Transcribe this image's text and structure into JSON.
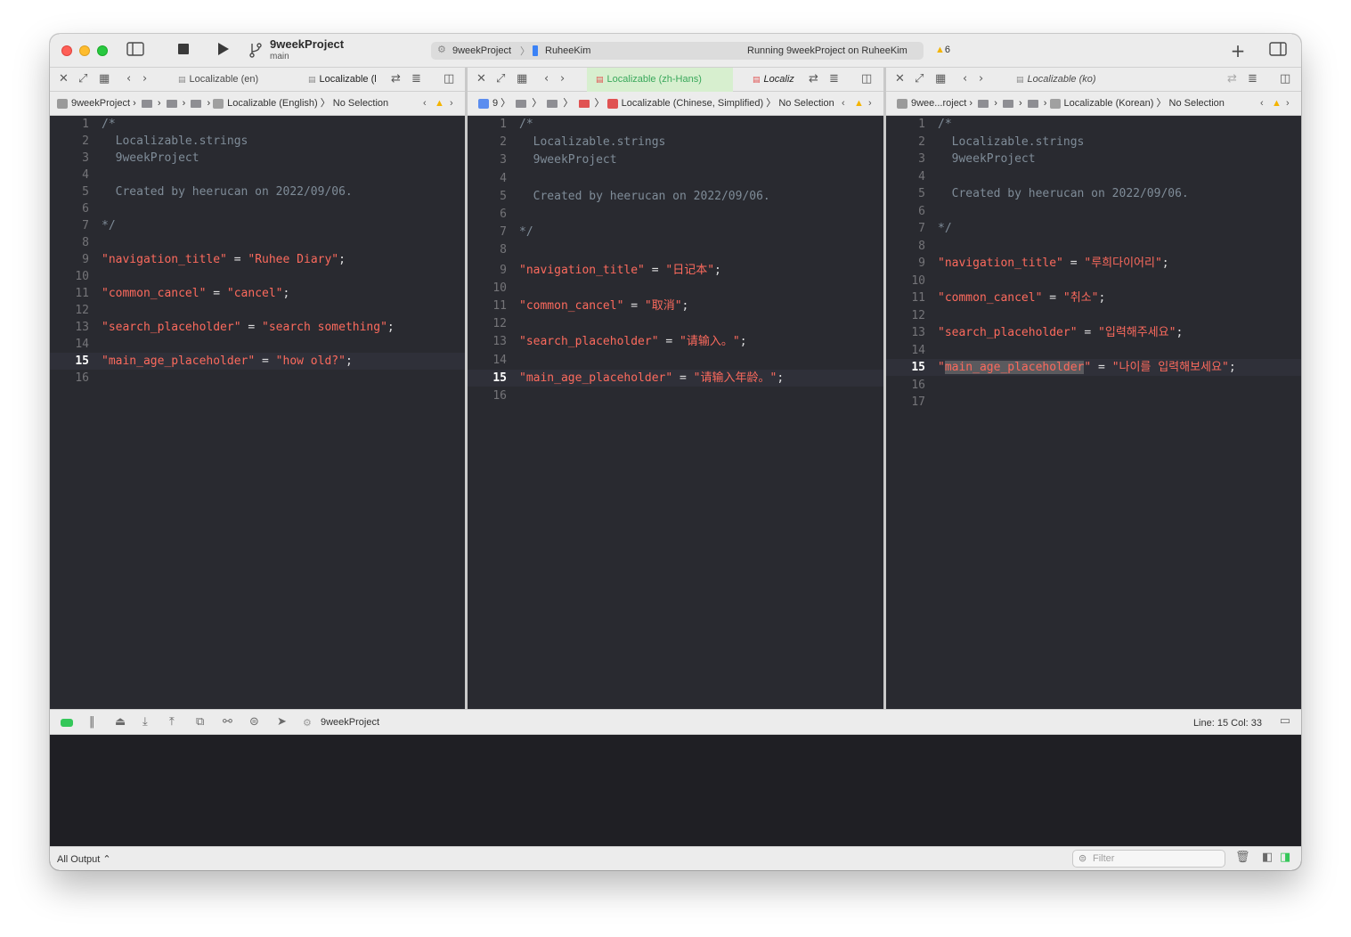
{
  "toolbar": {
    "project_title": "9weekProject",
    "branch": "main",
    "scheme_project": "9weekProject",
    "scheme_device": "RuheeKim",
    "status": "Running 9weekProject on RuheeKim",
    "warning_count": "6"
  },
  "editors": [
    {
      "tabs": [
        {
          "label": "Localizable (en)",
          "active": false
        },
        {
          "label": "Localizable (l",
          "active": false
        }
      ],
      "jumpbar": {
        "project": "9weekProject",
        "file": "Localizable (English)",
        "selection": "No Selection"
      },
      "lines": [
        {
          "n": "1",
          "parts": [
            {
              "c": "cm",
              "t": "/*"
            }
          ]
        },
        {
          "n": "2",
          "parts": [
            {
              "c": "cm",
              "t": "  Localizable.strings"
            }
          ]
        },
        {
          "n": "3",
          "parts": [
            {
              "c": "cm",
              "t": "  9weekProject"
            }
          ]
        },
        {
          "n": "4",
          "parts": []
        },
        {
          "n": "5",
          "parts": [
            {
              "c": "cm",
              "t": "  Created by heerucan on 2022/09/06."
            }
          ]
        },
        {
          "n": "6",
          "parts": []
        },
        {
          "n": "7",
          "parts": [
            {
              "c": "cm",
              "t": "*/"
            }
          ]
        },
        {
          "n": "8",
          "parts": []
        },
        {
          "n": "9",
          "parts": [
            {
              "c": "str",
              "t": "\"navigation_title\""
            },
            {
              "c": "op",
              "t": " = "
            },
            {
              "c": "str",
              "t": "\"Ruhee Diary\""
            },
            {
              "c": "op",
              "t": ";"
            }
          ]
        },
        {
          "n": "10",
          "parts": []
        },
        {
          "n": "11",
          "parts": [
            {
              "c": "str",
              "t": "\"common_cancel\""
            },
            {
              "c": "op",
              "t": " = "
            },
            {
              "c": "str",
              "t": "\"cancel\""
            },
            {
              "c": "op",
              "t": ";"
            }
          ]
        },
        {
          "n": "12",
          "parts": []
        },
        {
          "n": "13",
          "parts": [
            {
              "c": "str",
              "t": "\"search_placeholder\""
            },
            {
              "c": "op",
              "t": " = "
            },
            {
              "c": "str",
              "t": "\"search something\""
            },
            {
              "c": "op",
              "t": ";"
            }
          ]
        },
        {
          "n": "14",
          "parts": []
        },
        {
          "n": "15",
          "current": true,
          "parts": [
            {
              "c": "str",
              "t": "\"main_age_placeholder\""
            },
            {
              "c": "op",
              "t": " = "
            },
            {
              "c": "str",
              "t": "\"how old?\""
            },
            {
              "c": "op",
              "t": ";"
            }
          ]
        },
        {
          "n": "16",
          "parts": []
        }
      ]
    },
    {
      "tabs": [
        {
          "label": "Localizable (zh-Hans)",
          "active": true
        },
        {
          "label": "Localiz",
          "active": false
        }
      ],
      "jumpbar": {
        "project": "9",
        "file": "Localizable (Chinese, Simplified)",
        "selection": "No Selection"
      },
      "lines": [
        {
          "n": "1",
          "parts": [
            {
              "c": "cm",
              "t": "/*"
            }
          ]
        },
        {
          "n": "2",
          "parts": [
            {
              "c": "cm",
              "t": "  Localizable.strings"
            }
          ]
        },
        {
          "n": "3",
          "parts": [
            {
              "c": "cm",
              "t": "  9weekProject"
            }
          ]
        },
        {
          "n": "4",
          "parts": []
        },
        {
          "n": "5",
          "parts": [
            {
              "c": "cm",
              "t": "  Created by heerucan on 2022/09/06."
            }
          ]
        },
        {
          "n": "6",
          "parts": []
        },
        {
          "n": "7",
          "parts": [
            {
              "c": "cm",
              "t": "*/"
            }
          ]
        },
        {
          "n": "8",
          "parts": []
        },
        {
          "n": "9",
          "parts": [
            {
              "c": "str",
              "t": "\"navigation_title\""
            },
            {
              "c": "op",
              "t": " = "
            },
            {
              "c": "str",
              "t": "\"日记本\""
            },
            {
              "c": "op",
              "t": ";"
            }
          ]
        },
        {
          "n": "10",
          "parts": []
        },
        {
          "n": "11",
          "parts": [
            {
              "c": "str",
              "t": "\"common_cancel\""
            },
            {
              "c": "op",
              "t": " = "
            },
            {
              "c": "str",
              "t": "\"取消\""
            },
            {
              "c": "op",
              "t": ";"
            }
          ]
        },
        {
          "n": "12",
          "parts": []
        },
        {
          "n": "13",
          "parts": [
            {
              "c": "str",
              "t": "\"search_placeholder\""
            },
            {
              "c": "op",
              "t": " = "
            },
            {
              "c": "str",
              "t": "\"请输入。\""
            },
            {
              "c": "op",
              "t": ";"
            }
          ]
        },
        {
          "n": "14",
          "parts": []
        },
        {
          "n": "15",
          "current": true,
          "parts": [
            {
              "c": "str",
              "t": "\"main_age_placeholder\""
            },
            {
              "c": "op",
              "t": " = "
            },
            {
              "c": "str",
              "t": "\"请输入年龄。\""
            },
            {
              "c": "op",
              "t": ";"
            }
          ]
        },
        {
          "n": "16",
          "parts": []
        }
      ]
    },
    {
      "tabs": [
        {
          "label": "Localizable (ko)",
          "active": false
        }
      ],
      "jumpbar": {
        "project": "9wee...roject",
        "file": "Localizable (Korean)",
        "selection": "No Selection"
      },
      "lines": [
        {
          "n": "1",
          "parts": [
            {
              "c": "cm",
              "t": "/*"
            }
          ]
        },
        {
          "n": "2",
          "parts": [
            {
              "c": "cm",
              "t": "  Localizable.strings"
            }
          ]
        },
        {
          "n": "3",
          "parts": [
            {
              "c": "cm",
              "t": "  9weekProject"
            }
          ]
        },
        {
          "n": "4",
          "parts": []
        },
        {
          "n": "5",
          "parts": [
            {
              "c": "cm",
              "t": "  Created by heerucan on 2022/09/06."
            }
          ]
        },
        {
          "n": "6",
          "parts": []
        },
        {
          "n": "7",
          "parts": [
            {
              "c": "cm",
              "t": "*/"
            }
          ]
        },
        {
          "n": "8",
          "parts": []
        },
        {
          "n": "9",
          "parts": [
            {
              "c": "str",
              "t": "\"navigation_title\""
            },
            {
              "c": "op",
              "t": " = "
            },
            {
              "c": "str",
              "t": "\"루희다이어리\""
            },
            {
              "c": "op",
              "t": ";"
            }
          ]
        },
        {
          "n": "10",
          "parts": []
        },
        {
          "n": "11",
          "parts": [
            {
              "c": "str",
              "t": "\"common_cancel\""
            },
            {
              "c": "op",
              "t": " = "
            },
            {
              "c": "str",
              "t": "\"취소\""
            },
            {
              "c": "op",
              "t": ";"
            }
          ]
        },
        {
          "n": "12",
          "parts": []
        },
        {
          "n": "13",
          "parts": [
            {
              "c": "str",
              "t": "\"search_placeholder\""
            },
            {
              "c": "op",
              "t": " = "
            },
            {
              "c": "str",
              "t": "\"입력해주세요\""
            },
            {
              "c": "op",
              "t": ";"
            }
          ]
        },
        {
          "n": "14",
          "parts": []
        },
        {
          "n": "15",
          "current": true,
          "parts": [
            {
              "c": "str",
              "t": "\""
            },
            {
              "c": "str hl",
              "t": "main_age_placeholder"
            },
            {
              "c": "str",
              "t": "\""
            },
            {
              "c": "op",
              "t": " = "
            },
            {
              "c": "str",
              "t": "\"나이를 입력해보세요\""
            },
            {
              "c": "op",
              "t": ";"
            }
          ]
        },
        {
          "n": "16",
          "parts": []
        },
        {
          "n": "17",
          "parts": []
        }
      ]
    }
  ],
  "debugbar": {
    "process": "9weekProject",
    "line_col": "Line: 15  Col: 33"
  },
  "console": {
    "output_menu": "All Output ⌃",
    "filter_placeholder": "Filter"
  },
  "colors": {
    "editor_bg": "#292a30",
    "string": "#fc6a5d",
    "comment": "#7f8c98",
    "active_tab_text": "#3aa85b",
    "warning": "#f4b400"
  }
}
